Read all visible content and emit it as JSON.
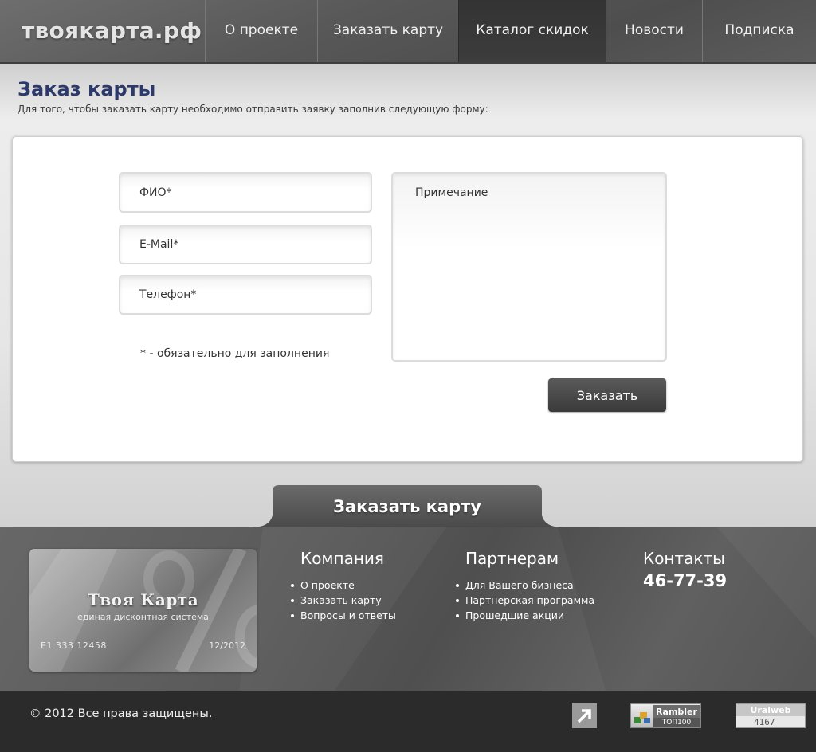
{
  "header": {
    "logo": "твоякарта.рф",
    "nav": [
      {
        "label": "О проекте",
        "active": false
      },
      {
        "label": "Заказать карту",
        "active": false
      },
      {
        "label": "Каталог скидок",
        "active": true
      },
      {
        "label": "Новости",
        "active": false
      },
      {
        "label": "Подписка",
        "active": false
      }
    ]
  },
  "page": {
    "title": "Заказ карты",
    "subtitle": "Для того, чтобы заказать карту необходимо отправить заявку заполнив следующую форму:"
  },
  "form": {
    "name_placeholder": "ФИО*",
    "email_placeholder": "E-Mail*",
    "phone_placeholder": "Телефон*",
    "note_placeholder": "Примечание",
    "required_note": "* - обязательно для заполнения",
    "submit_label": "Заказать"
  },
  "order_tab": {
    "label": "Заказать карту"
  },
  "footer": {
    "card": {
      "title": "Твоя Карта",
      "subtitle": "единая дисконтная система",
      "number": "E1 333 12458",
      "date": "12/2012"
    },
    "company": {
      "title": "Компания",
      "links": [
        "О проекте",
        "Заказать карту",
        "Вопросы и ответы"
      ]
    },
    "partners": {
      "title": "Партнерам",
      "links": [
        "Для Вашего бизнеса",
        "Партнерская программа",
        "Прошедшие акции"
      ]
    },
    "contacts": {
      "title": "Контакты",
      "phone": "46-77-39"
    }
  },
  "bottom": {
    "copyright": "© 2012 Все права защищены.",
    "rambler": {
      "name": "Rambler",
      "sub": "ТОП100"
    },
    "uralweb": {
      "name": "Uralweb",
      "count": "4167"
    }
  },
  "colors": {
    "title_blue": "#2b3a6b",
    "header_gray": "#585858",
    "active_nav": "#333333",
    "footer_dark": "#2b2b2b"
  }
}
